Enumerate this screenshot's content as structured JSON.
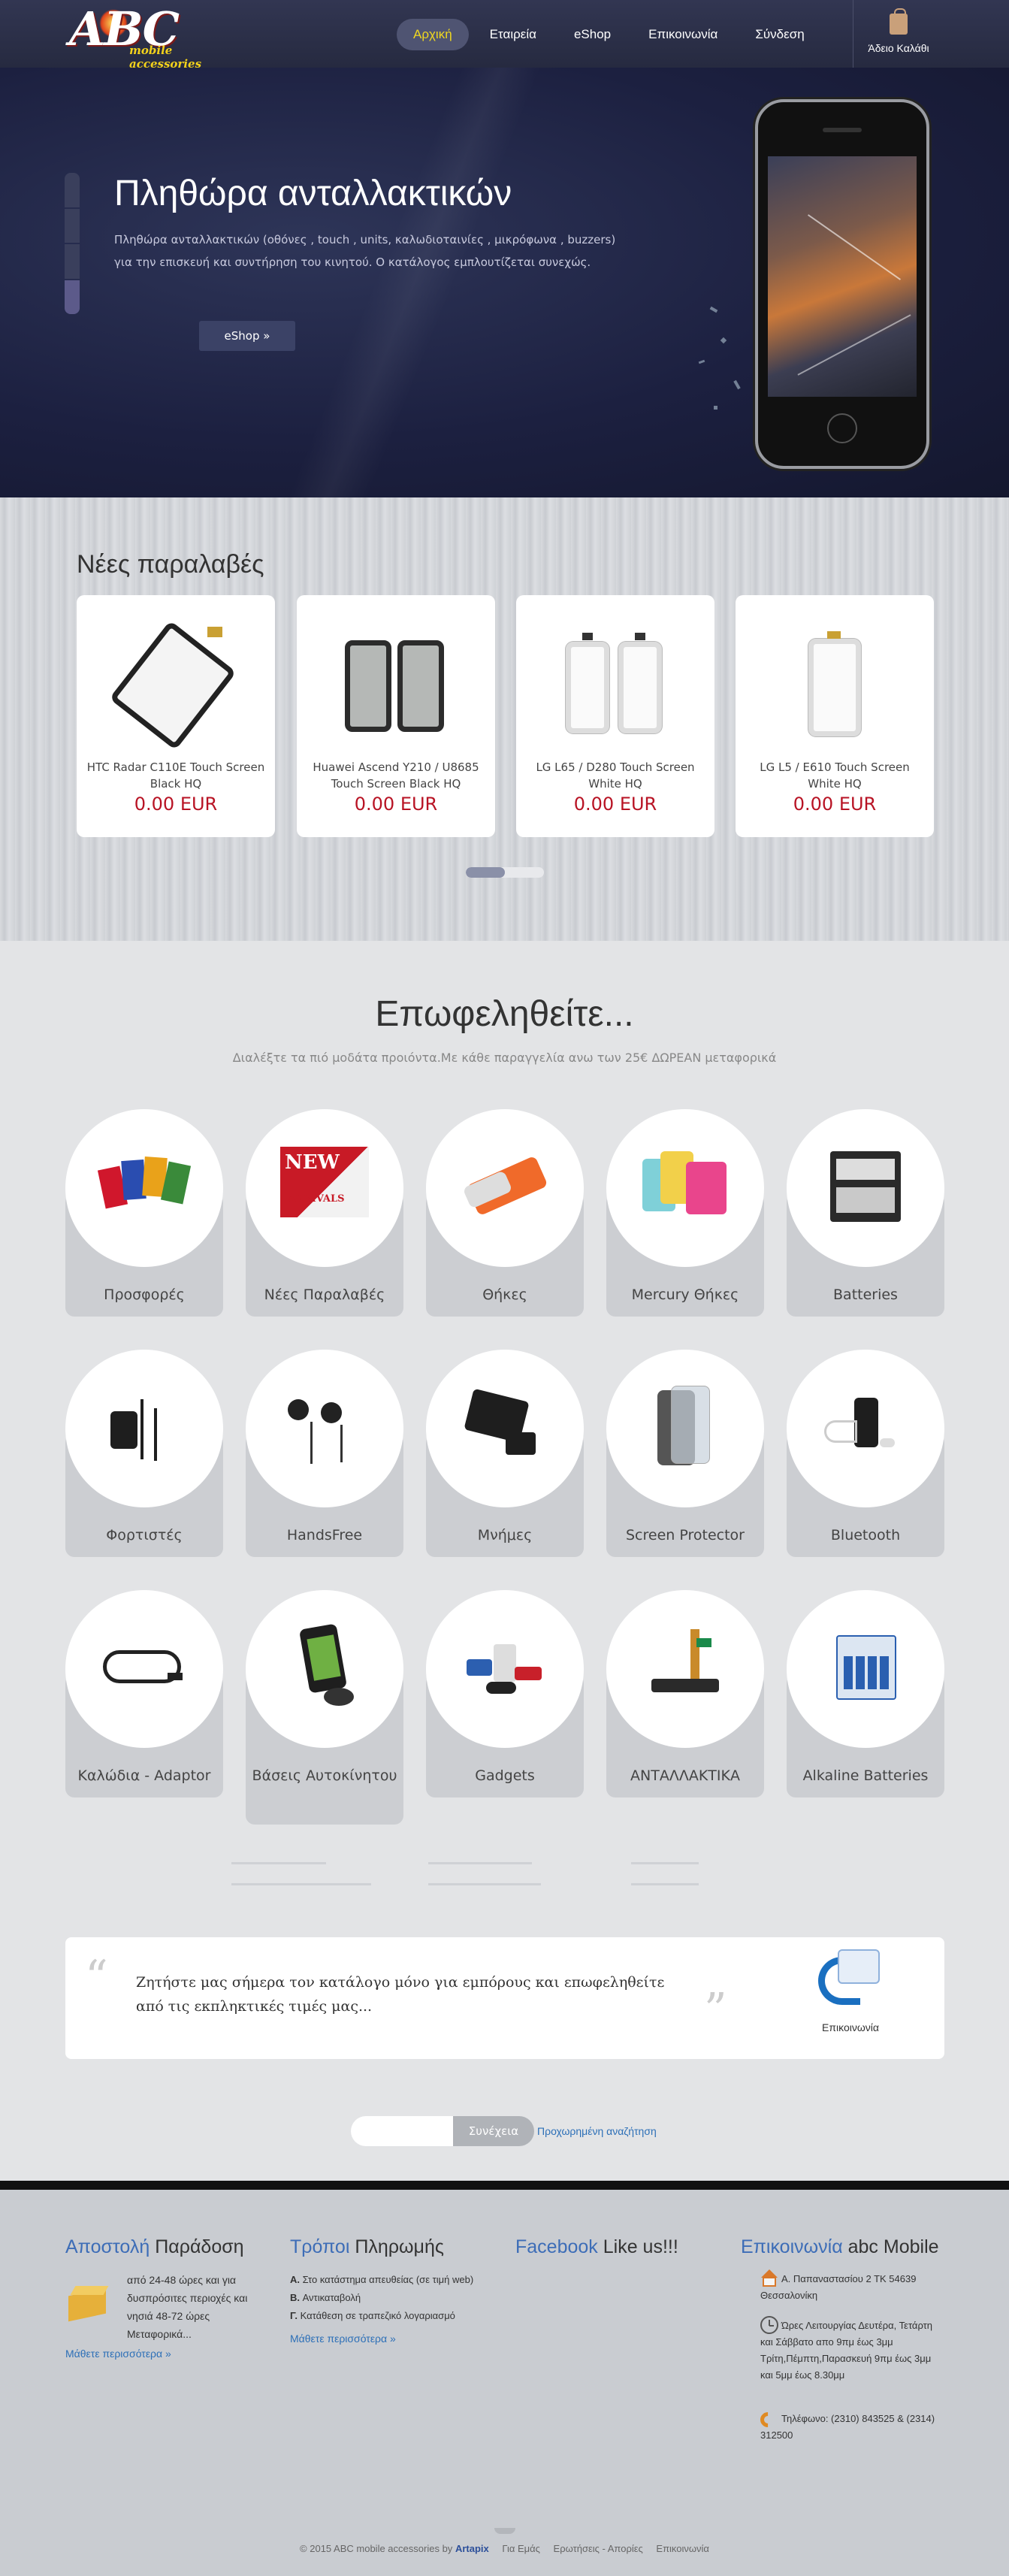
{
  "logo": {
    "brand": "ABC",
    "tagline": "mobile accessories"
  },
  "nav": {
    "items": [
      "Αρχική",
      "Εταιρεία",
      "eShop",
      "Επικοινωνία",
      "Σύνδεση"
    ],
    "cart_label": "Άδειο Καλάθι"
  },
  "hero": {
    "title": "Πληθώρα ανταλλακτικών",
    "text": "Πληθώρα ανταλλακτικών (οθόνες , touch , units, καλωδιοταινίες , μικρόφωνα , buzzers) για την επισκευή και συντήρηση του κινητού. Ο κατάλογος εμπλουτίζεται συνεχώς.",
    "button": "eShop »"
  },
  "arrivals": {
    "title": "Νέες παραλαβές",
    "products": [
      {
        "name": "HTC Radar C110E Touch Screen Black HQ",
        "price": "0.00 EUR"
      },
      {
        "name": "Huawei Ascend Y210 / U8685 Touch Screen Black HQ",
        "price": "0.00 EUR"
      },
      {
        "name": "LG L65 / D280 Touch Screen White HQ",
        "price": "0.00 EUR"
      },
      {
        "name": "LG L5 / E610 Touch Screen White HQ",
        "price": "0.00 EUR"
      }
    ]
  },
  "benefit": {
    "title": "Επωφεληθείτε...",
    "lead": "Διαλέξτε τα πιό μοδάτα προιόντα.Με κάθε παραγγελία ανω των 25€ ΔΩΡΕΑΝ μεταφορικά",
    "categories": [
      "Προσφορές",
      "Νέες Παραλαβές",
      "Θήκες",
      "Mercury Θήκες",
      "Batteries",
      "Φορτιστές",
      "HandsFree",
      "Μνήμες",
      "Screen Protector",
      "Bluetooth",
      "Καλώδια - Adaptor",
      "Βάσεις Αυτοκίνητου",
      "Gadgets",
      "ΑΝΤΑΛΛΑΚΤΙΚΑ",
      "Alkaline Batteries"
    ]
  },
  "quote": {
    "text": "Ζητήστε μας σήμερα τον κατάλογο μόνο για εμπόρους και επωφεληθείτε από τις εκπληκτικές τιμές μας...",
    "contact_label": "Επικοινωνία"
  },
  "search": {
    "button": "Συνέχεια",
    "advanced": "Προχωρημένη αναζήτηση"
  },
  "footer": {
    "delivery": {
      "title_hl": "Αποστολή",
      "title": "Παράδοση",
      "text": "από 24-48 ώρες και για δυσπρόσιτες περιοχές και νησιά 48-72 ώρες Μεταφορικά...",
      "more": "Μάθετε περισσότερα »"
    },
    "payment": {
      "title_hl": "Τρόποι",
      "title": "Πληρωμής",
      "items": [
        {
          "key": "A.",
          "text": "Στο κατάστημα απευθείας (σε τιμή web)"
        },
        {
          "key": "B.",
          "text": "Αντικαταβολή"
        },
        {
          "key": "Γ.",
          "text": "Κατάθεση σε τραπεζικό λογαριασμό"
        }
      ],
      "more": "Μάθετε περισσότερα »"
    },
    "facebook": {
      "title_hl": "Facebook",
      "title": "Like us!!!"
    },
    "contact": {
      "title_hl": "Επικοινωνία",
      "title": "abc Mobile",
      "address": "Α. Παπαναστασίου 2 ΤΚ 54639 Θεσσαλονίκη",
      "hours": "Ώρες Λειτουργίας Δευτέρα, Τετάρτη και Σάββατο απο 9πμ έως 3μμ Τρίτη,Πέμπτη,Παρασκευή 9πμ έως 3μμ και 5μμ έως 8.30μμ",
      "phone": "Τηλέφωνο: (2310) 843525 & (2314) 312500"
    },
    "copyright": "© 2015 ABC mobile accessories",
    "by_prefix": "by",
    "by": "Artapix",
    "links": [
      "Για Εμάς",
      "Ερωτήσεις - Απορίες",
      "Επικοινωνία"
    ]
  }
}
